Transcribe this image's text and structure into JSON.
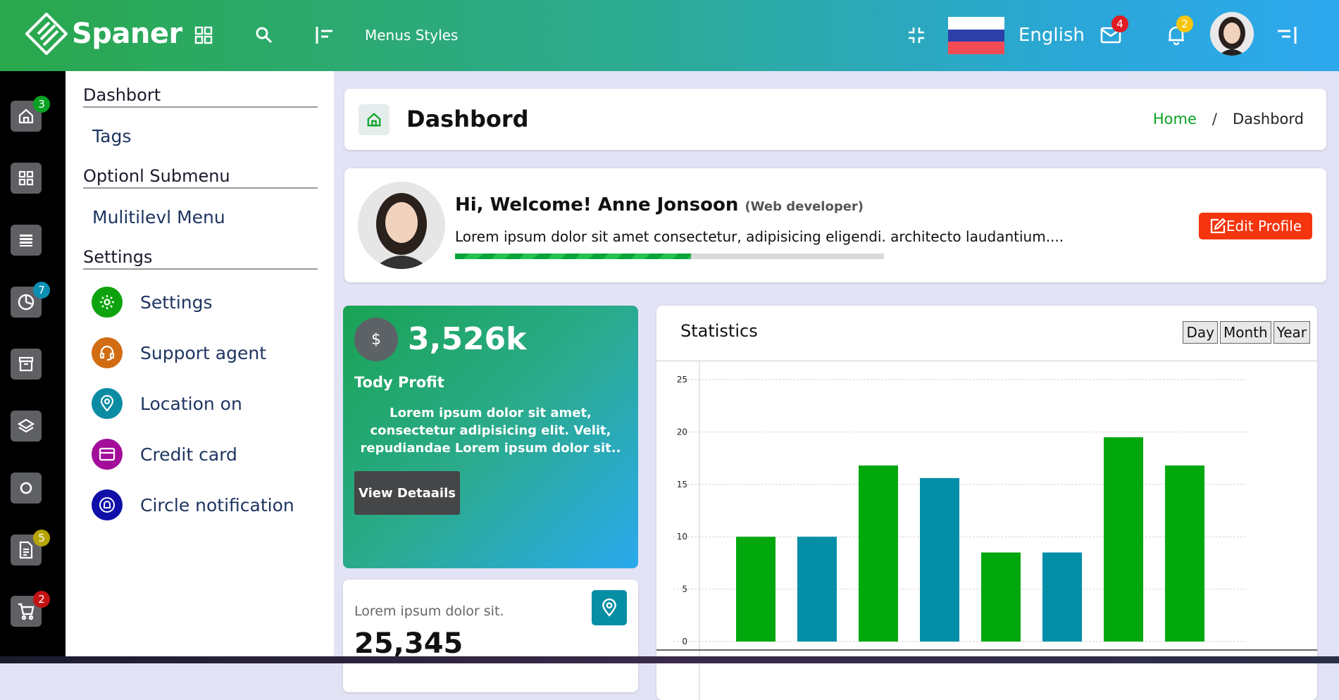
{
  "topbar": {
    "brand": "Spaner",
    "menus_styles": "Menus Styles",
    "language": "English",
    "mail_count": "4",
    "notification_count": "2",
    "colors": {
      "mail_badge": "#e11b22",
      "notification_badge": "#f5c50e"
    }
  },
  "rail": {
    "items": [
      {
        "icon": "home-icon",
        "badge": "3",
        "badge_color": "#09a223"
      },
      {
        "icon": "grid-icon"
      },
      {
        "icon": "list-icon"
      },
      {
        "icon": "pie-chart-icon",
        "badge": "7",
        "badge_color": "#0a8fb3"
      },
      {
        "icon": "archive-icon"
      },
      {
        "icon": "layers-icon"
      },
      {
        "icon": "circle-icon"
      },
      {
        "icon": "document-icon",
        "badge": "5",
        "badge_color": "#b5a507"
      },
      {
        "icon": "cart-icon",
        "badge": "2",
        "badge_color": "#c41313"
      }
    ]
  },
  "submenu": {
    "headings": [
      "Dashbort",
      "Optionl Submenu",
      "Settings"
    ],
    "links": [
      "Tags",
      "Mulitilevl Menu"
    ],
    "items": [
      {
        "label": "Settings",
        "icon": "gear-icon",
        "color": "#0ea30e"
      },
      {
        "label": "Support agent",
        "icon": "headset-icon",
        "color": "#d26c12"
      },
      {
        "label": "Location on",
        "icon": "location-pin-icon",
        "color": "#0b8ca3"
      },
      {
        "label": "Credit card",
        "icon": "credit-card-icon",
        "color": "#a20e9a"
      },
      {
        "label": "Circle notification",
        "icon": "notification-bell-icon",
        "color": "#1010a8"
      }
    ]
  },
  "header": {
    "title": "Dashbord",
    "breadcrumb_home": "Home",
    "breadcrumb_sep": "/",
    "breadcrumb_current": "Dashbord"
  },
  "welcome": {
    "greeting": "Hi, Welcome! Anne Jonsoon",
    "role": "(Web developer)",
    "text": "Lorem ipsum dolor sit amet consectetur, adipisicing eligendi. architecto laudantium....",
    "progress": 0.55,
    "edit_label": "Edit Profile"
  },
  "profit": {
    "currency_symbol": "$",
    "value": "3,526k",
    "title": "Tody Profit",
    "text": "Lorem ipsum dolor sit amet, consectetur adipisicing elit. Velit, repudiandae Lorem ipsum dolor sit..",
    "button": "View Detaails"
  },
  "small_card": {
    "label": "Lorem ipsum dolor sit.",
    "value": "25,345"
  },
  "statistics": {
    "title": "Statistics",
    "periods": [
      "Day",
      "Month",
      "Year"
    ]
  },
  "chart_data": {
    "type": "bar",
    "ylim": [
      0,
      25
    ],
    "yticks": [
      0,
      5,
      10,
      15,
      20,
      25
    ],
    "values": [
      10,
      10,
      16.8,
      15.6,
      8.5,
      8.5,
      19.5,
      16.8
    ],
    "colors": [
      "#00a80e",
      "#028ea7",
      "#00a80e",
      "#028ea7",
      "#00a80e",
      "#028ea7",
      "#00a80e",
      "#00a80e"
    ],
    "grid": true
  }
}
